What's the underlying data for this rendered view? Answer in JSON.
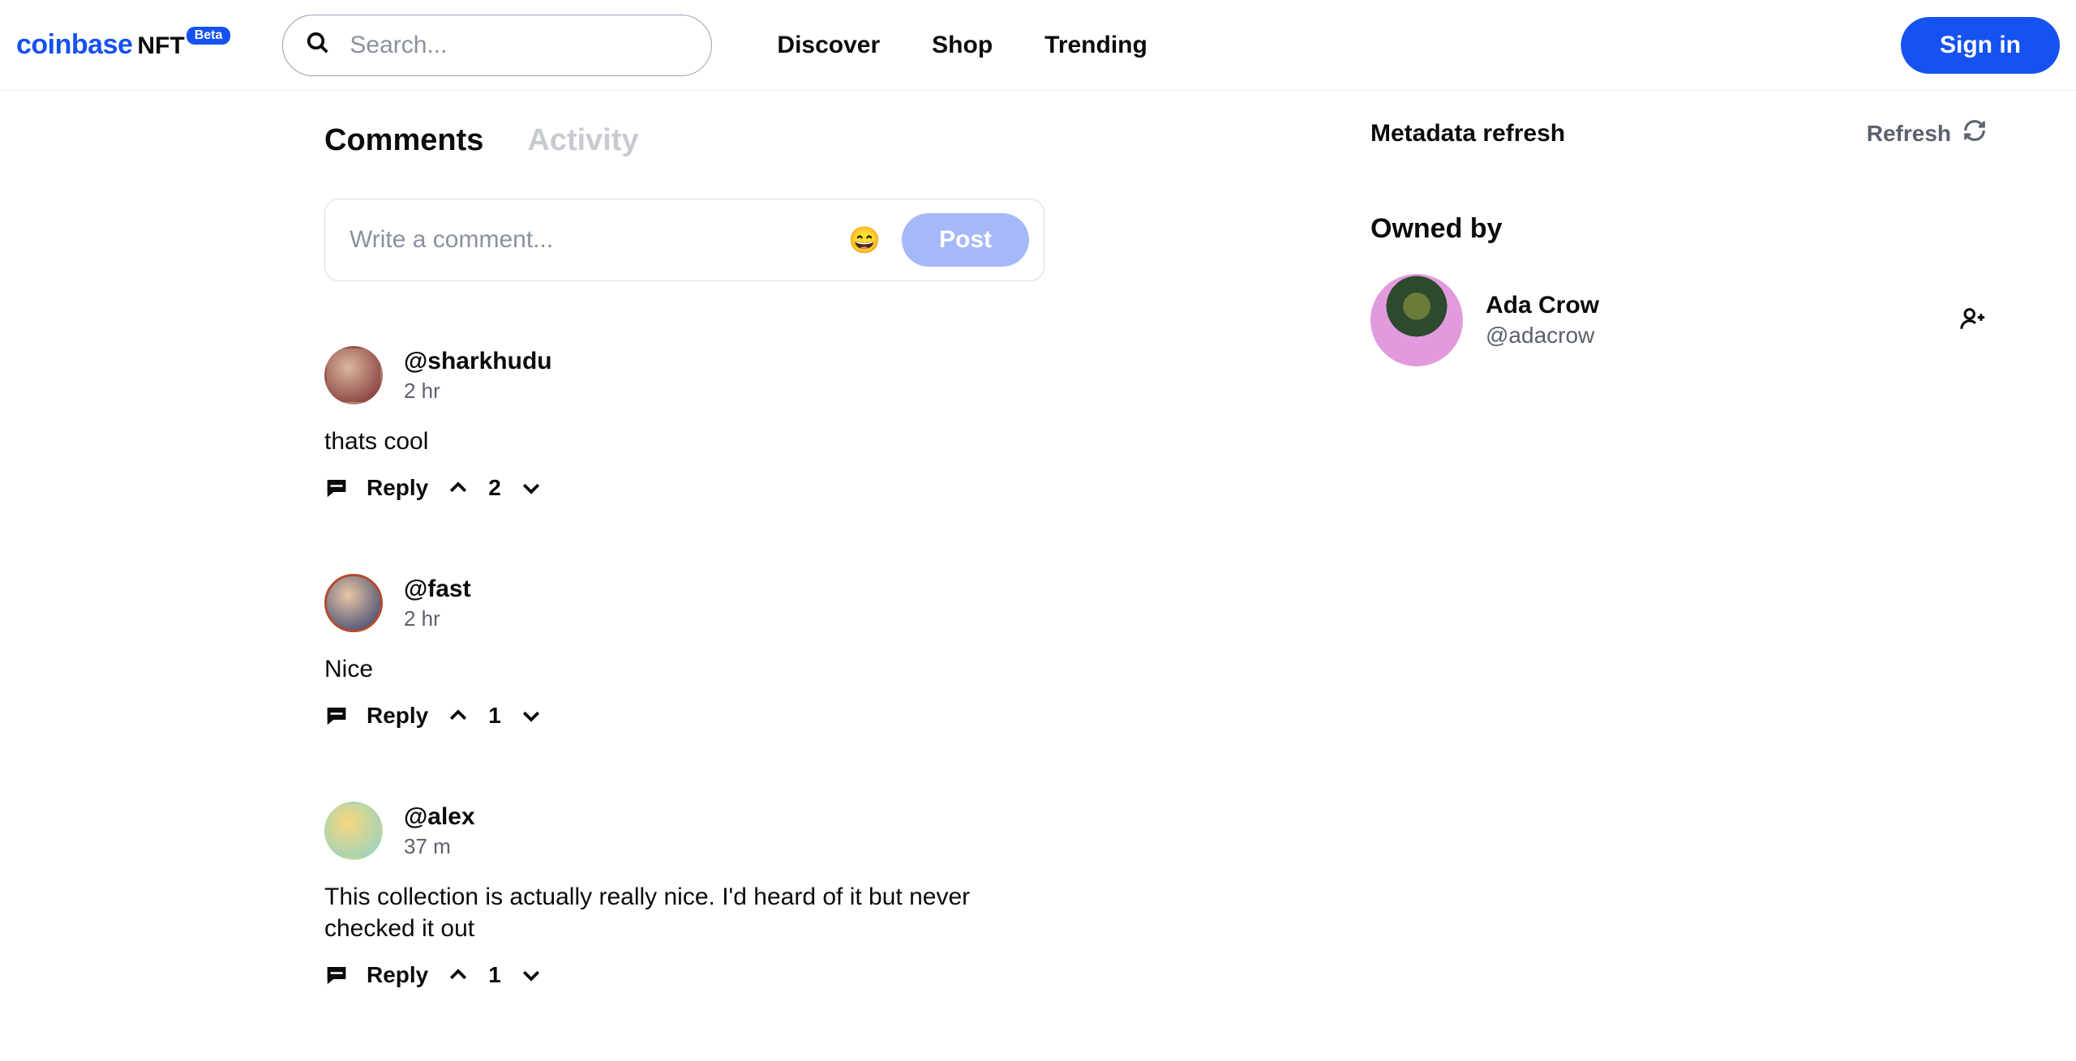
{
  "header": {
    "logo_main": "coinbase",
    "logo_nft": "NFT",
    "beta": "Beta",
    "search_placeholder": "Search...",
    "nav": {
      "discover": "Discover",
      "shop": "Shop",
      "trending": "Trending"
    },
    "signin": "Sign in"
  },
  "tabs": {
    "comments": "Comments",
    "activity": "Activity"
  },
  "compose": {
    "placeholder": "Write a comment...",
    "emoji": "😄",
    "post": "Post"
  },
  "comments": [
    {
      "user": "@sharkhudu",
      "time": "2 hr",
      "body": "thats cool",
      "votes": "2",
      "avatar": {
        "a1": "#d9b7a0",
        "a2": "#7a2b2b",
        "ring": "transparent"
      }
    },
    {
      "user": "@fast",
      "time": "2 hr",
      "body": "Nice",
      "votes": "1",
      "avatar": {
        "a1": "#e8c6a6",
        "a2": "#2b3b6b",
        "ring": "#b54a2d"
      }
    },
    {
      "user": "@alex",
      "time": "37 m",
      "body": "This collection is actually really nice. I'd heard of it but never checked it out",
      "votes": "1",
      "avatar": {
        "a1": "#f5d77d",
        "a2": "#8fd3c7",
        "ring": "transparent"
      }
    }
  ],
  "labels": {
    "reply": "Reply"
  },
  "right": {
    "metadata_label": "Metadata refresh",
    "refresh_label": "Refresh",
    "owned_by": "Owned by",
    "owner_name": "Ada Crow",
    "owner_handle": "@adacrow"
  }
}
